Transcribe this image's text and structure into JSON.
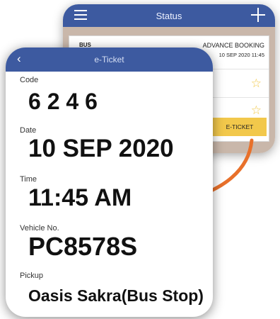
{
  "status_screen": {
    "title": "Status",
    "bus_label": "BUS",
    "booking_type": "ADVANCE BOOKING",
    "booking_datetime": "10 SEP 2020 11:45",
    "eticket_button": "E-TICKET"
  },
  "eticket_screen": {
    "title": "e-Ticket",
    "fields": {
      "code": {
        "label": "Code",
        "value": "6 2 4 6"
      },
      "date": {
        "label": "Date",
        "value": "10 SEP 2020"
      },
      "time": {
        "label": "Time",
        "value": "11:45 AM"
      },
      "vehicle": {
        "label": "Vehicle No.",
        "value": "PC8578S"
      },
      "pickup": {
        "label": "Pickup",
        "value": "Oasis Sakra(Bus Stop)"
      }
    }
  },
  "colors": {
    "header": "#3d5aa0",
    "eticket_button": "#f2c84b",
    "green_button": "#4fae5d",
    "arrow": "#e8702a",
    "star": "#f2c94c"
  },
  "icons": [
    "menu-icon",
    "plus-icon",
    "back-chevron-icon",
    "star-icon",
    "arrow-icon"
  ]
}
